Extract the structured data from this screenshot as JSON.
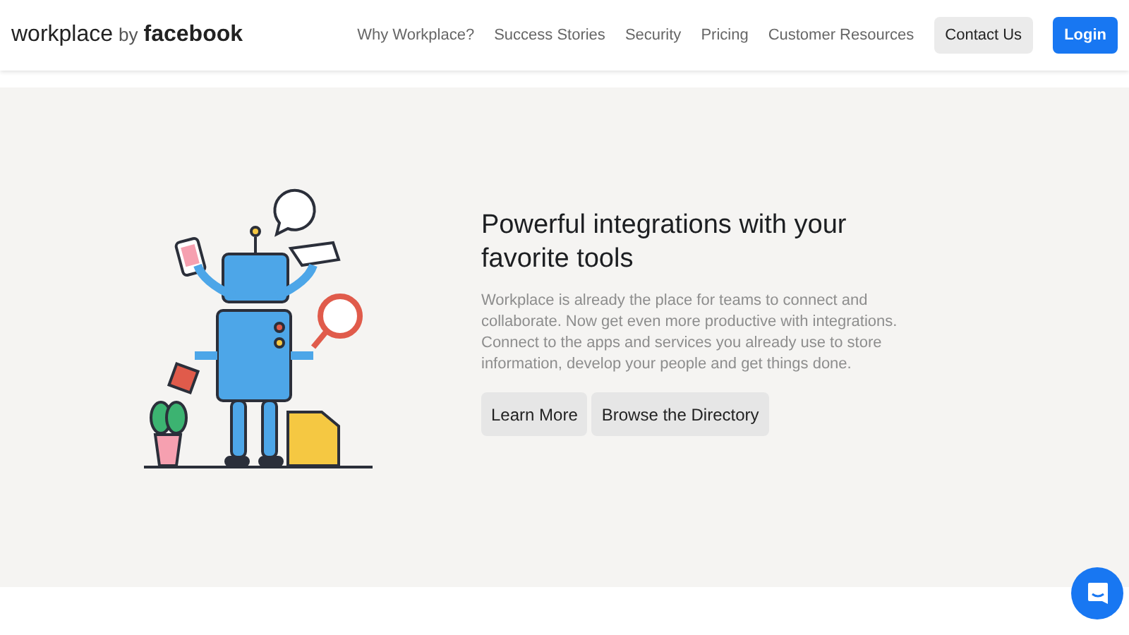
{
  "header": {
    "logo": {
      "brand": "workplace",
      "by": "by",
      "company": "facebook"
    },
    "nav": [
      "Why Workplace?",
      "Success Stories",
      "Security",
      "Pricing",
      "Customer Resources"
    ],
    "buttons": [
      {
        "label": "Contact Us",
        "kind": "secondary"
      },
      {
        "label": "Login",
        "kind": "primary"
      }
    ]
  },
  "hero": {
    "title": "Powerful integrations with your favorite tools",
    "body": "Workplace is already the place for teams to connect and collaborate. Now get even more productive with integrations. Connect to the apps and services you already use to store information, develop your people and get things done.",
    "buttons": [
      "Learn More",
      "Browse the Directory"
    ]
  }
}
